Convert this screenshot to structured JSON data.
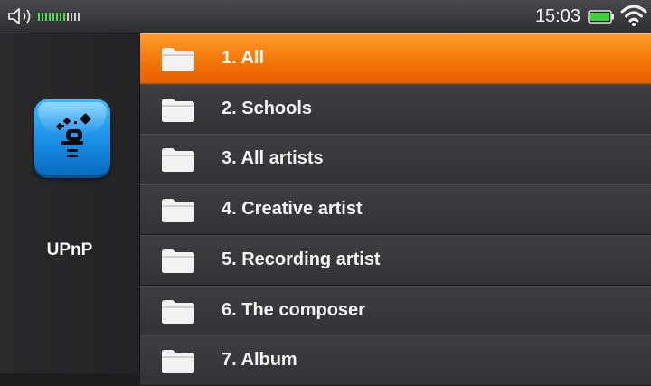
{
  "status_bar": {
    "time": "15:03",
    "volume_level": 0.7,
    "battery_level": 1.0,
    "icons": [
      "speaker-icon",
      "battery-icon",
      "wifi-icon"
    ]
  },
  "sidebar": {
    "app_label": "UPnP",
    "app_icon": "upnp-icon",
    "app_icon_color": "#1a8fe6"
  },
  "menu": {
    "selected_index": 0,
    "accent_color": "#f57a0a",
    "items": [
      {
        "label": "1.  All",
        "icon": "folder-icon"
      },
      {
        "label": "2. Schools",
        "icon": "folder-icon"
      },
      {
        "label": "3. All artists",
        "icon": "folder-icon"
      },
      {
        "label": "4. Creative artist",
        "icon": "folder-icon"
      },
      {
        "label": "5. Recording artist",
        "icon": "folder-icon"
      },
      {
        "label": "6. The composer",
        "icon": "folder-icon"
      },
      {
        "label": "7. Album",
        "icon": "folder-icon"
      }
    ]
  }
}
